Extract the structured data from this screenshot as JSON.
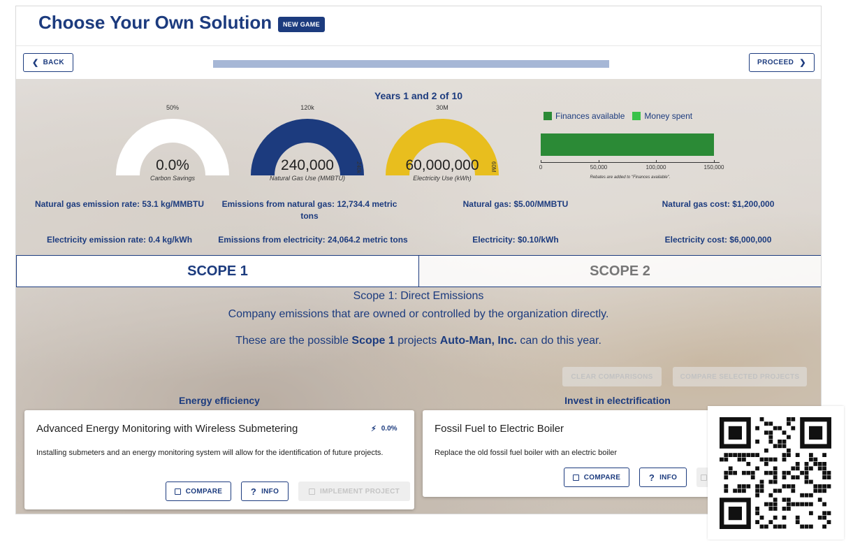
{
  "header": {
    "title": "Choose Your Own Solution",
    "new_game_label": "NEW GAME"
  },
  "nav": {
    "back_label": "BACK",
    "proceed_label": "PROCEED",
    "progress_fraction": 1.0
  },
  "dashboard": {
    "years_label": "Years 1 and 2 of 10",
    "gauges": [
      {
        "max_label": "50%",
        "value": "0.0%",
        "caption": "Carbon Savings",
        "color": "#ffffff",
        "fill_fraction": 1.0,
        "side_label": ""
      },
      {
        "max_label": "120k",
        "value": "240,000",
        "caption": "Natural Gas Use (MMBTU)",
        "color": "#1c3b7e",
        "fill_fraction": 1.0,
        "side_label": "240k"
      },
      {
        "max_label": "30M",
        "value": "60,000,000",
        "caption": "Electricity Use (kWh)",
        "color": "#e8be1e",
        "fill_fraction": 1.0,
        "side_label": "60M"
      }
    ],
    "finances": {
      "legend": [
        {
          "label": "Finances available",
          "color": "#2b8a36"
        },
        {
          "label": "Money spent",
          "color": "#39c24a"
        }
      ],
      "value": 150000,
      "max": 155000,
      "ticks": [
        "0",
        "50,000",
        "100,000",
        "150,000"
      ],
      "tick_values": [
        0,
        50000,
        100000,
        150000
      ],
      "note": "Rebates are added to \"Finances available\"."
    },
    "metrics": {
      "ng_rate": "Natural gas emission rate: 53.1 kg/MMBTU",
      "ng_emissions": "Emissions from natural gas: 12,734.4 metric tons",
      "ng_price": "Natural gas: $5.00/MMBTU",
      "ng_cost": "Natural gas cost: $1,200,000",
      "el_rate": "Electricity emission rate: 0.4 kg/kWh",
      "el_emissions": "Emissions from electricity: 24,064.2 metric tons",
      "el_price": "Electricity: $0.10/kWh",
      "el_cost": "Electricity cost: $6,000,000"
    }
  },
  "scope_tabs": {
    "scope1": "SCOPE 1",
    "scope2": "SCOPE 2"
  },
  "scope1": {
    "heading": "Scope 1: Direct Emissions",
    "subheading": "Company emissions that are owned or controlled by the organization directly.",
    "line_prefix": "These are the possible ",
    "line_scope": "Scope 1",
    "line_mid": " projects ",
    "line_company": "Auto-Man, Inc.",
    "line_suffix": " can do this year.",
    "clear_label": "CLEAR COMPARISONS",
    "compare_selected_label": "COMPARE SELECTED PROJECTS"
  },
  "columns": [
    {
      "heading": "Energy efficiency",
      "card": {
        "title": "Advanced Energy Monitoring with Wireless Submetering",
        "stat": "0.0%",
        "description": "Installing submeters and an energy monitoring system will allow for the identification of future projects.",
        "compare_label": "COMPARE",
        "info_label": "INFO",
        "implement_label": "IMPLEMENT PROJECT"
      }
    },
    {
      "heading": "Invest in electrification",
      "card": {
        "title": "Fossil Fuel to Electric Boiler",
        "description": "Replace the old fossil fuel boiler with an electric boiler",
        "compare_label": "COMPARE",
        "info_label": "INFO"
      }
    }
  ]
}
